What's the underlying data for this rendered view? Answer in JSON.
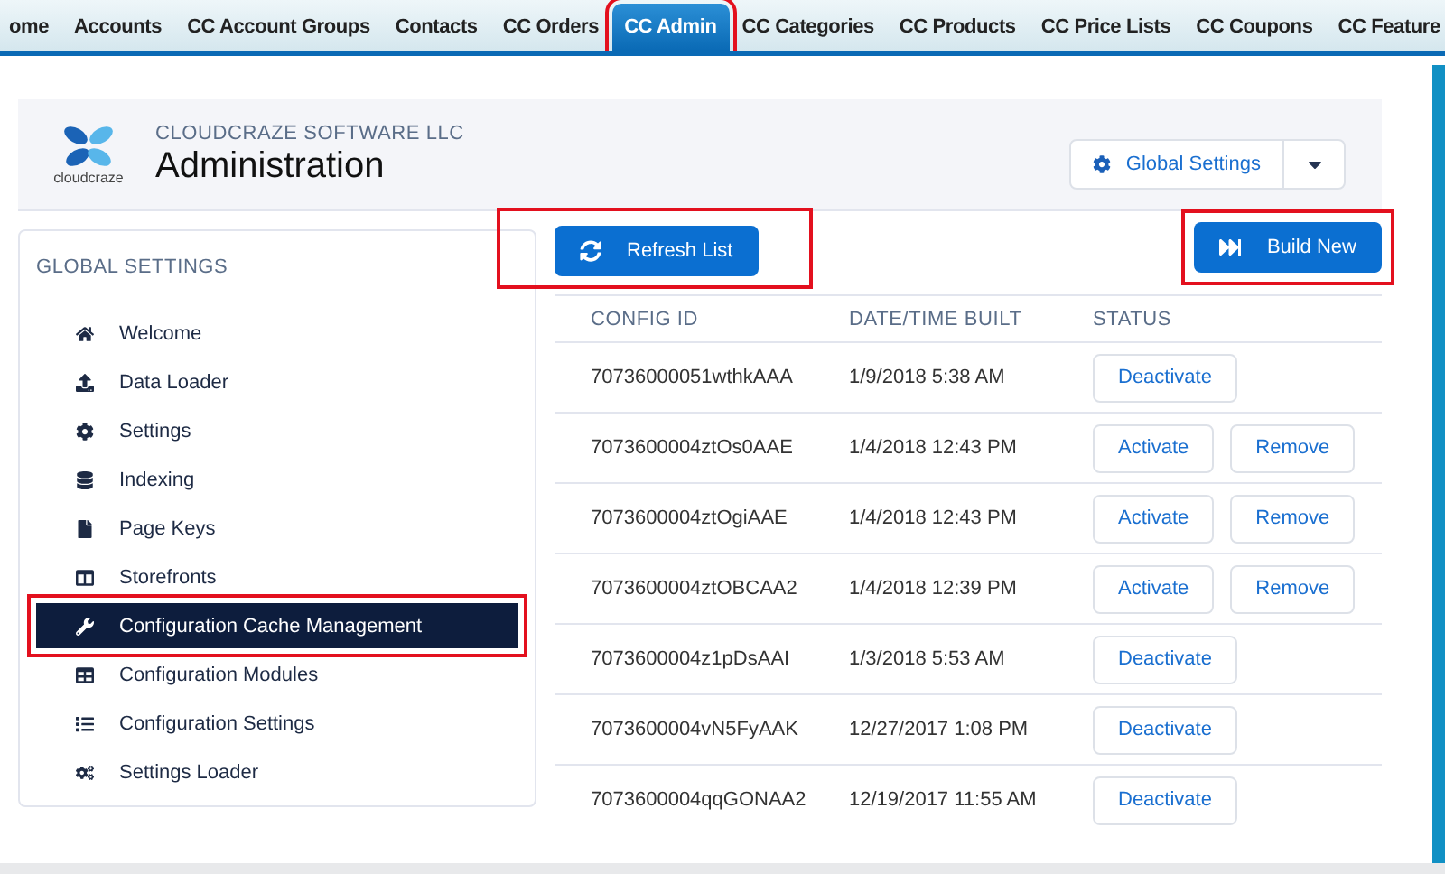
{
  "nav_tabs": [
    {
      "label": "ome",
      "selected": false,
      "highlighted": false
    },
    {
      "label": "Accounts",
      "selected": false,
      "highlighted": false
    },
    {
      "label": "CC Account Groups",
      "selected": false,
      "highlighted": false
    },
    {
      "label": "Contacts",
      "selected": false,
      "highlighted": false
    },
    {
      "label": "CC Orders",
      "selected": false,
      "highlighted": false
    },
    {
      "label": "CC Admin",
      "selected": true,
      "highlighted": true
    },
    {
      "label": "CC Categories",
      "selected": false,
      "highlighted": false
    },
    {
      "label": "CC Products",
      "selected": false,
      "highlighted": false
    },
    {
      "label": "CC Price Lists",
      "selected": false,
      "highlighted": false
    },
    {
      "label": "CC Coupons",
      "selected": false,
      "highlighted": false
    },
    {
      "label": "CC Feature",
      "selected": false,
      "highlighted": false
    }
  ],
  "header": {
    "logo_text": "cloudcraze",
    "company": "CLOUDCRAZE SOFTWARE LLC",
    "title": "Administration",
    "settings_button": "Global Settings"
  },
  "sidebar": {
    "heading": "GLOBAL SETTINGS",
    "items": [
      {
        "label": "Welcome",
        "selected": false,
        "highlighted": false
      },
      {
        "label": "Data Loader",
        "selected": false,
        "highlighted": false
      },
      {
        "label": "Settings",
        "selected": false,
        "highlighted": false
      },
      {
        "label": "Indexing",
        "selected": false,
        "highlighted": false
      },
      {
        "label": "Page Keys",
        "selected": false,
        "highlighted": false
      },
      {
        "label": "Storefronts",
        "selected": false,
        "highlighted": false
      },
      {
        "label": "Configuration Cache Management",
        "selected": true,
        "highlighted": true
      },
      {
        "label": "Configuration Modules",
        "selected": false,
        "highlighted": false
      },
      {
        "label": "Configuration Settings",
        "selected": false,
        "highlighted": false
      },
      {
        "label": "Settings Loader",
        "selected": false,
        "highlighted": false
      }
    ]
  },
  "toolbar": {
    "refresh_button": {
      "label": "Refresh List",
      "highlighted": true
    },
    "build_button": {
      "label": "Build New",
      "highlighted": true
    }
  },
  "table": {
    "columns": [
      "CONFIG ID",
      "DATE/TIME BUILT",
      "STATUS"
    ],
    "rows": [
      {
        "config_id": "70736000051wthkAAA",
        "built": "1/9/2018 5:38 AM",
        "actions": [
          "Deactivate"
        ]
      },
      {
        "config_id": "7073600004ztOs0AAE",
        "built": "1/4/2018 12:43 PM",
        "actions": [
          "Activate",
          "Remove"
        ]
      },
      {
        "config_id": "7073600004ztOgiAAE",
        "built": "1/4/2018 12:43 PM",
        "actions": [
          "Activate",
          "Remove"
        ]
      },
      {
        "config_id": "7073600004ztOBCAA2",
        "built": "1/4/2018 12:39 PM",
        "actions": [
          "Activate",
          "Remove"
        ]
      },
      {
        "config_id": "7073600004z1pDsAAI",
        "built": "1/3/2018 5:53 AM",
        "actions": [
          "Deactivate"
        ]
      },
      {
        "config_id": "7073600004vN5FyAAK",
        "built": "12/27/2017 1:08 PM",
        "actions": [
          "Deactivate"
        ]
      },
      {
        "config_id": "7073600004qqGONAA2",
        "built": "12/19/2017 11:55 AM",
        "actions": [
          "Deactivate"
        ]
      }
    ]
  }
}
